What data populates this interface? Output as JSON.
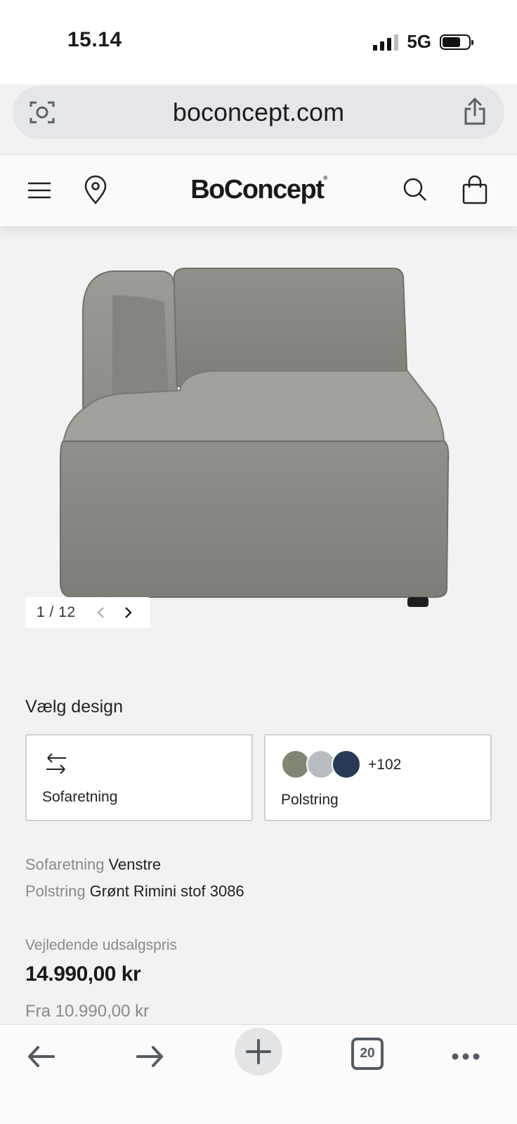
{
  "status_bar": {
    "time": "15.14",
    "network": "5G",
    "battery_level": 0.7
  },
  "browser": {
    "url": "boconcept.com",
    "icons": {
      "left": "lens-icon",
      "right": "share-icon"
    }
  },
  "header": {
    "brand": "BoConcept",
    "brand_mark": "®",
    "icons": [
      "menu-icon",
      "location-pin-icon",
      "search-icon",
      "shopping-bag-icon"
    ]
  },
  "gallery": {
    "counter": "1 / 12",
    "current": 1,
    "total": 12
  },
  "design": {
    "title": "Vælg design",
    "options": [
      {
        "label": "Sofaretning",
        "icon": "swap-arrows-icon"
      },
      {
        "label": "Polstring",
        "swatches": [
          "#7e8770",
          "#b9bcc0",
          "#283a55"
        ],
        "more": "+102"
      }
    ]
  },
  "selection": [
    {
      "key": "Sofaretning",
      "value": "Venstre"
    },
    {
      "key": "Polstring",
      "value": "Grønt Rimini stof 3086"
    }
  ],
  "price": {
    "caption": "Vejledende udsalgspris",
    "amount": "14.990,00 kr",
    "from": "Fra 10.990,00 kr"
  },
  "bottom_bar": {
    "tab_count": "20",
    "icons": [
      "back-arrow-icon",
      "forward-arrow-icon",
      "new-tab-plus-icon",
      "tabs-icon",
      "more-icon"
    ]
  }
}
